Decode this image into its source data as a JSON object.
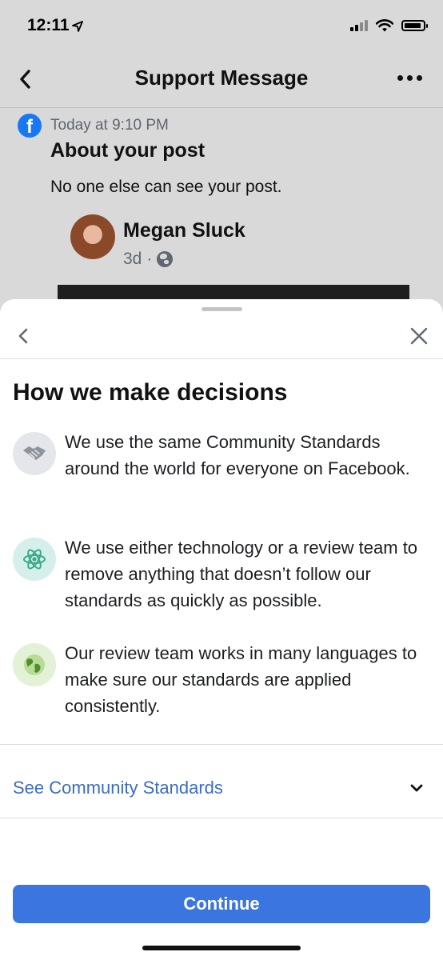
{
  "status_bar": {
    "time": "12:11"
  },
  "nav": {
    "title": "Support Message"
  },
  "message": {
    "timestamp": "Today at 9:10 PM",
    "heading": "About your post",
    "body": "No one else can see your post.",
    "post": {
      "author": "Megan Sluck",
      "age": "3d",
      "separator": "·"
    }
  },
  "sheet": {
    "title": "How we make decisions",
    "reasons": [
      {
        "icon": "handshake-icon",
        "text": "We use the same Community Standards around the world for everyone on Facebook."
      },
      {
        "icon": "atom-icon",
        "text": "We use either technology or a review team to remove anything that doesn’t follow our standards as quickly as possible."
      },
      {
        "icon": "globe-icon",
        "text": "Our review team works in many languages to make sure our standards are applied consistently."
      }
    ],
    "expand_link": "See Community Standards",
    "continue_label": "Continue"
  },
  "colors": {
    "accent": "#3b76e0",
    "link": "#3b6cc4",
    "facebook_blue": "#1877f2",
    "dim_background": "#d9d9d9"
  }
}
